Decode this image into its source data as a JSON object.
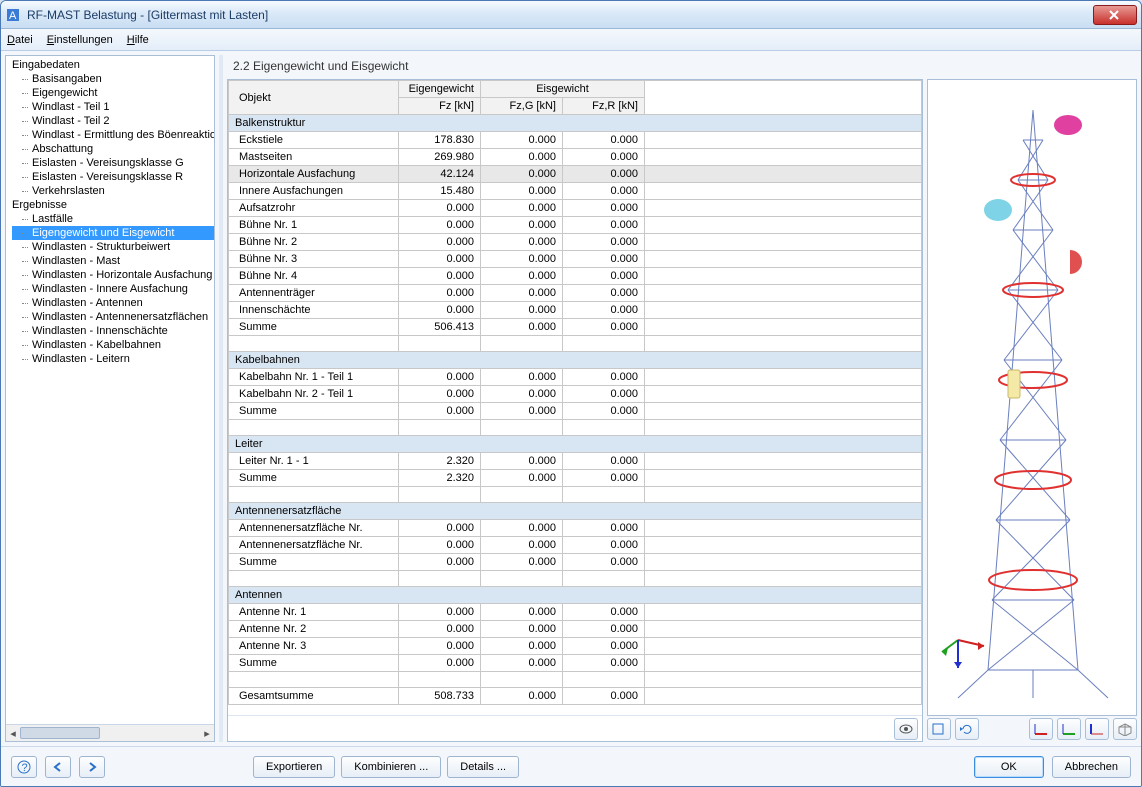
{
  "window": {
    "title": "RF-MAST Belastung - [Gittermast mit Lasten]"
  },
  "menu": {
    "file": "Datei",
    "settings": "Einstellungen",
    "help": "Hilfe"
  },
  "tree": {
    "input_header": "Eingabedaten",
    "input": [
      "Basisangaben",
      "Eigengewicht",
      "Windlast - Teil 1",
      "Windlast - Teil 2",
      "Windlast - Ermittlung des Böenreaktions",
      "Abschattung",
      "Eislasten - Vereisungsklasse G",
      "Eislasten - Vereisungsklasse R",
      "Verkehrslasten"
    ],
    "results_header": "Ergebnisse",
    "results": [
      "Lastfälle",
      "Eigengewicht und Eisgewicht",
      "Windlasten - Strukturbeiwert",
      "Windlasten - Mast",
      "Windlasten - Horizontale Ausfachung",
      "Windlasten - Innere Ausfachung",
      "Windlasten - Antennen",
      "Windlasten - Antennenersatzflächen",
      "Windlasten - Innenschächte",
      "Windlasten - Kabelbahnen",
      "Windlasten - Leitern"
    ],
    "selected_result_index": 1
  },
  "page": {
    "title": "2.2 Eigengewicht und Eisgewicht"
  },
  "table": {
    "headers": {
      "object": "Objekt",
      "eigen_group": "Eigengewicht",
      "eis_group": "Eisgewicht",
      "fz": "Fz [kN]",
      "fzg": "Fz,G [kN]",
      "fzr": "Fz,R [kN]"
    },
    "sections": [
      {
        "title": "Balkenstruktur",
        "rows": [
          {
            "obj": "Eckstiele",
            "fz": "178.830",
            "fzg": "0.000",
            "fzr": "0.000"
          },
          {
            "obj": "Mastseiten",
            "fz": "269.980",
            "fzg": "0.000",
            "fzr": "0.000"
          },
          {
            "obj": "Horizontale Ausfachung",
            "fz": "42.124",
            "fzg": "0.000",
            "fzr": "0.000",
            "selected": true
          },
          {
            "obj": "Innere Ausfachungen",
            "fz": "15.480",
            "fzg": "0.000",
            "fzr": "0.000"
          },
          {
            "obj": "Aufsatzrohr",
            "fz": "0.000",
            "fzg": "0.000",
            "fzr": "0.000"
          },
          {
            "obj": "Bühne Nr. 1",
            "fz": "0.000",
            "fzg": "0.000",
            "fzr": "0.000"
          },
          {
            "obj": "Bühne Nr. 2",
            "fz": "0.000",
            "fzg": "0.000",
            "fzr": "0.000"
          },
          {
            "obj": "Bühne Nr. 3",
            "fz": "0.000",
            "fzg": "0.000",
            "fzr": "0.000"
          },
          {
            "obj": "Bühne Nr. 4",
            "fz": "0.000",
            "fzg": "0.000",
            "fzr": "0.000"
          },
          {
            "obj": "Antennenträger",
            "fz": "0.000",
            "fzg": "0.000",
            "fzr": "0.000"
          },
          {
            "obj": "Innenschächte",
            "fz": "0.000",
            "fzg": "0.000",
            "fzr": "0.000"
          },
          {
            "obj": "Summe",
            "fz": "506.413",
            "fzg": "0.000",
            "fzr": "0.000"
          }
        ]
      },
      {
        "title": "Kabelbahnen",
        "rows": [
          {
            "obj": "Kabelbahn Nr. 1 - Teil 1",
            "fz": "0.000",
            "fzg": "0.000",
            "fzr": "0.000"
          },
          {
            "obj": "Kabelbahn Nr. 2 - Teil 1",
            "fz": "0.000",
            "fzg": "0.000",
            "fzr": "0.000"
          },
          {
            "obj": "Summe",
            "fz": "0.000",
            "fzg": "0.000",
            "fzr": "0.000"
          }
        ]
      },
      {
        "title": "Leiter",
        "rows": [
          {
            "obj": "Leiter Nr. 1 - 1",
            "fz": "2.320",
            "fzg": "0.000",
            "fzr": "0.000"
          },
          {
            "obj": "Summe",
            "fz": "2.320",
            "fzg": "0.000",
            "fzr": "0.000"
          }
        ]
      },
      {
        "title": "Antennenersatzfläche",
        "rows": [
          {
            "obj": "Antennenersatzfläche Nr.",
            "fz": "0.000",
            "fzg": "0.000",
            "fzr": "0.000"
          },
          {
            "obj": "Antennenersatzfläche Nr.",
            "fz": "0.000",
            "fzg": "0.000",
            "fzr": "0.000"
          },
          {
            "obj": "Summe",
            "fz": "0.000",
            "fzg": "0.000",
            "fzr": "0.000"
          }
        ]
      },
      {
        "title": "Antennen",
        "rows": [
          {
            "obj": "Antenne Nr. 1",
            "fz": "0.000",
            "fzg": "0.000",
            "fzr": "0.000"
          },
          {
            "obj": "Antenne Nr. 2",
            "fz": "0.000",
            "fzg": "0.000",
            "fzr": "0.000"
          },
          {
            "obj": "Antenne Nr. 3",
            "fz": "0.000",
            "fzg": "0.000",
            "fzr": "0.000"
          },
          {
            "obj": "Summe",
            "fz": "0.000",
            "fzg": "0.000",
            "fzr": "0.000"
          }
        ]
      }
    ],
    "total": {
      "obj": "Gesamtsumme",
      "fz": "508.733",
      "fzg": "0.000",
      "fzr": "0.000"
    }
  },
  "buttons": {
    "export": "Exportieren",
    "combine": "Kombinieren ...",
    "details": "Details ...",
    "ok": "OK",
    "cancel": "Abbrechen"
  }
}
